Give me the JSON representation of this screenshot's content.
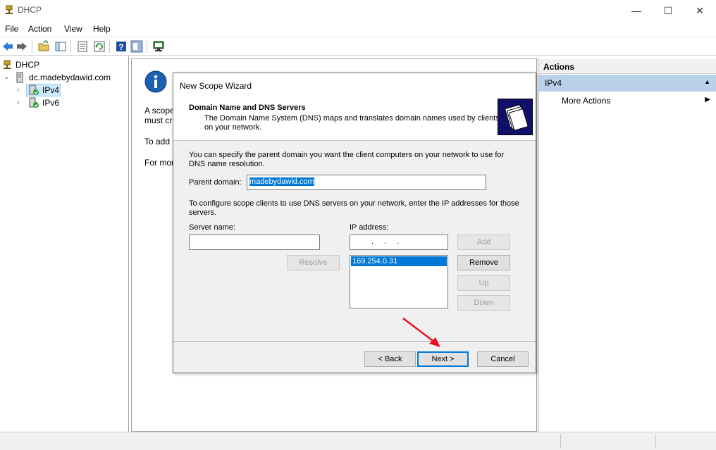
{
  "window": {
    "title": "DHCP",
    "minimize_glyph": "—",
    "maximize_glyph": "☐",
    "close_glyph": "✕"
  },
  "menu": [
    "File",
    "Action",
    "View",
    "Help"
  ],
  "tree": {
    "root": "DHCP",
    "server": "dc.madebydawid.com",
    "ipv4": "IPv4",
    "ipv6": "IPv6"
  },
  "center": {
    "line1a": "A scope",
    "line1b": "must cr",
    "line2": "To add",
    "line3": "For mor"
  },
  "actions": {
    "header": "Actions",
    "section": "IPv4",
    "more": "More Actions"
  },
  "dialog": {
    "title": "New Scope Wizard",
    "header_title": "Domain Name and DNS Servers",
    "header_desc": "The Domain Name System (DNS) maps and translates domain names used by clients on your network.",
    "intro": "You can specify the parent domain you want the client computers on your network to use for DNS name resolution.",
    "parent_domain_label": "Parent domain:",
    "parent_domain_value": "madebydawid.com",
    "dns_intro": "To configure scope clients to use DNS servers on your network, enter the IP addresses for those servers.",
    "server_name_label": "Server name:",
    "ip_address_label": "IP address:",
    "ip_placeholder": ".   .   .",
    "ip_list": [
      "169.254.0.31"
    ],
    "buttons": {
      "add": "Add",
      "resolve": "Resolve",
      "remove": "Remove",
      "up": "Up",
      "down": "Down",
      "back": "< Back",
      "next": "Next >",
      "cancel": "Cancel"
    }
  },
  "colors": {
    "accent": "#0078d7",
    "selection_light": "#b9d1ea",
    "arrow": "#e81123"
  }
}
